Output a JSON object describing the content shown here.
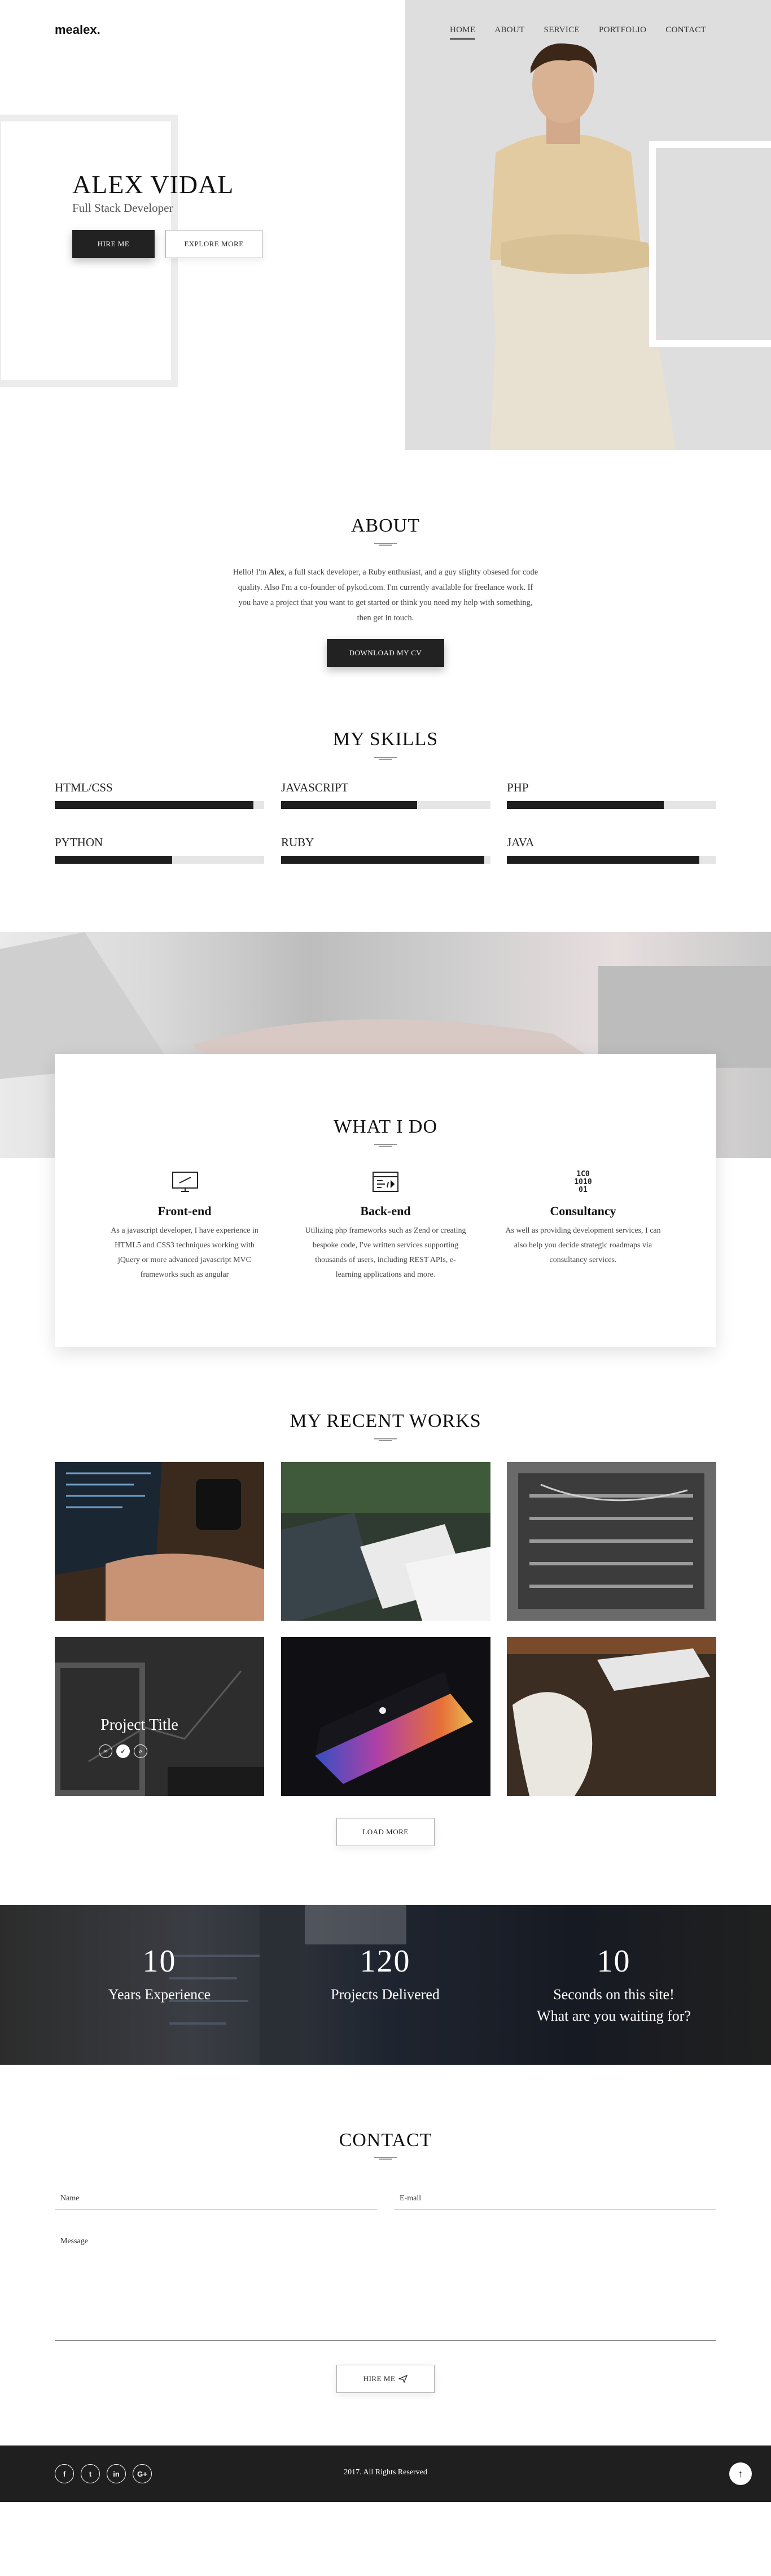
{
  "header": {
    "brand": "mealex.",
    "nav": [
      "HOME",
      "ABOUT",
      "SERVICE",
      "PORTFOLIO",
      "CONTACT"
    ]
  },
  "hero": {
    "name": "ALEX VIDAL",
    "role": "Full Stack Developer",
    "hire_label": "HIRE ME",
    "explore_label": "EXPLORE MORE"
  },
  "about": {
    "title": "ABOUT",
    "text_prefix": "Hello! I'm ",
    "text_name": "Alex",
    "text_body": ", a full stack developer, a Ruby enthusiast, and a guy slighty obsesed for code quality. Also I'm a co-founder of pykod.com. I'm currently available for freelance work. If you have a project that you want to get started or think you need my help with something, then get in touch.",
    "download_label": "DOWNLOAD MY CV"
  },
  "skills": {
    "title": "MY SKILLS",
    "items": [
      {
        "name": "HTML/CSS",
        "level": 0.95
      },
      {
        "name": "JAVASCRIPT",
        "level": 0.65
      },
      {
        "name": "PHP",
        "level": 0.75
      },
      {
        "name": "PYTHON",
        "level": 0.56
      },
      {
        "name": "RUBY",
        "level": 0.97
      },
      {
        "name": "JAVA",
        "level": 0.92
      }
    ]
  },
  "services": {
    "title": "WHAT I DO",
    "items": [
      {
        "title": "Front-end",
        "icon": "monitor-icon",
        "text": "As a javascript developer, I have experience in HTML5 and CSS3 techniques working with jQuery or more advanced javascript MVC frameworks such as angular"
      },
      {
        "title": "Back-end",
        "icon": "code-window-icon",
        "text": "Utilizing php frameworks such as Zend or creating bespoke code, I've written services supporting thousands of users, including REST APIs, e-learning applications and more."
      },
      {
        "title": "Consultancy",
        "icon": "binary-icon",
        "text": "As well as providing development services, I can also help you decide strategic roadmaps via consultancy services."
      }
    ]
  },
  "works": {
    "title": "MY RECENT WORKS",
    "hover_title": "Project Title",
    "load_more_label": "LOAD MORE",
    "colors": [
      "#3a2a1e",
      "#2f3b30",
      "#6a6a6a",
      "#2d2d2d",
      "#0f0f14",
      "#3b2d22"
    ]
  },
  "stats": {
    "items": [
      {
        "num": "10",
        "label": "Years Experience"
      },
      {
        "num": "120",
        "label": "Projects Delivered"
      },
      {
        "num": "10",
        "label": "Seconds on this site!",
        "label2": "What are you waiting for?"
      }
    ]
  },
  "contact": {
    "title": "CONTACT",
    "name_label": "Name",
    "email_label": "E-mail",
    "message_label": "Message",
    "submit_label": "HIRE ME"
  },
  "footer": {
    "copyright": "2017. All Rights Reserved",
    "social": [
      {
        "icon": "facebook-icon",
        "glyph": "f"
      },
      {
        "icon": "twitter-icon",
        "glyph": "t"
      },
      {
        "icon": "linkedin-icon",
        "glyph": "in"
      },
      {
        "icon": "google-plus-icon",
        "glyph": "G+"
      }
    ],
    "colors": {
      "accent": "#222222",
      "footer_bg": "#1f1f1f"
    }
  }
}
